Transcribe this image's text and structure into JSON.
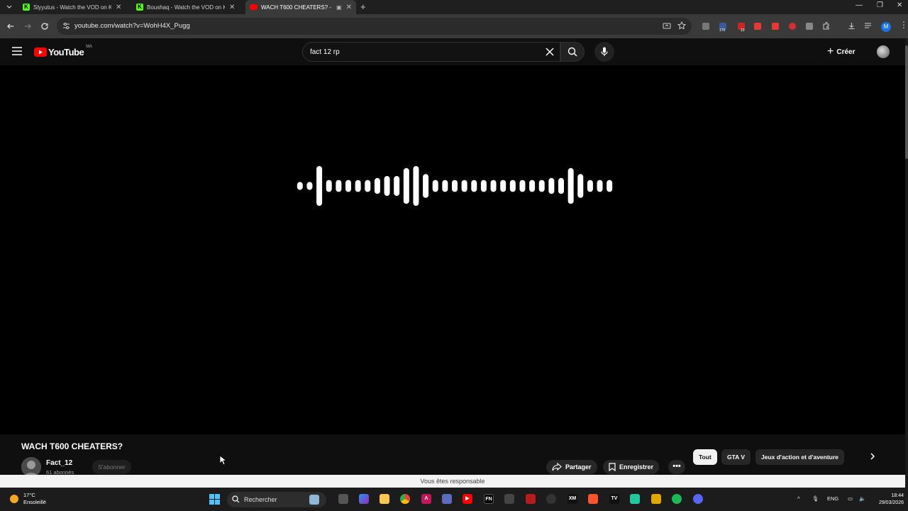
{
  "browser": {
    "tabs": [
      {
        "title": "Slyyutus - Watch the VOD on K",
        "favicon": "kick-icon",
        "color": "#53fc18",
        "active": false
      },
      {
        "title": "Boushaq - Watch the VOD on K",
        "favicon": "kick-icon",
        "color": "#53fc18",
        "active": false
      },
      {
        "title": "WACH T600 CHEATERS? - Y",
        "favicon": "youtube-icon",
        "color": "#ff0000",
        "active": true
      }
    ],
    "url": "youtube.com/watch?v=WohH4X_Pugg",
    "profile_initial": "M",
    "ext_badges": [
      "170",
      "10"
    ]
  },
  "youtube": {
    "logo_text": "YouTube",
    "country_code": "MA",
    "search_value": "fact 12 rp",
    "create_label": "Créer"
  },
  "video": {
    "title": "WACH T600 CHEATERS?",
    "channel_name": "Fact_12",
    "subscribers": "61 abonnés",
    "subscribe_label": "S'abonner",
    "share_label": "Partager",
    "save_label": "Enregistrer",
    "more_label": "•••",
    "waveform_levels": [
      0.2,
      0.2,
      1,
      0.3,
      0.3,
      0.3,
      0.3,
      0.3,
      0.4,
      0.5,
      0.5,
      0.9,
      1,
      0.6,
      0.3,
      0.3,
      0.3,
      0.3,
      0.3,
      0.3,
      0.3,
      0.3,
      0.3,
      0.3,
      0.3,
      0.3,
      0.4,
      0.4,
      0.9,
      0.6,
      0.3,
      0.3,
      0.3
    ]
  },
  "chips": [
    {
      "label": "Tout",
      "selected": true
    },
    {
      "label": "GTA V",
      "selected": false
    },
    {
      "label": "Jeux d'action et d'aventure",
      "selected": false
    }
  ],
  "notice": "Vous êtes responsable",
  "taskbar": {
    "temperature": "17°C",
    "weather": "Ensoleillé",
    "search_label": "Rechercher",
    "language": "ENG",
    "time": "18:44",
    "date": "29/03/2026"
  },
  "colors": {
    "accent": "#ff0000",
    "kick": "#53fc18",
    "windows_blue": "#4cc2ff"
  }
}
